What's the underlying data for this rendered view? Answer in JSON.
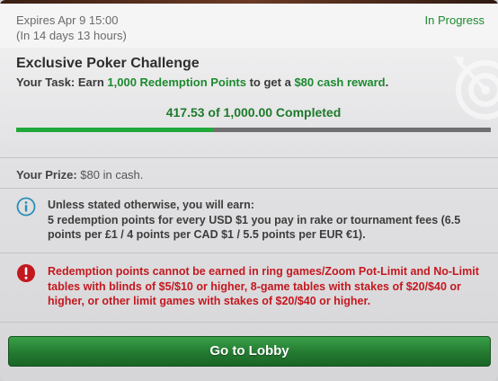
{
  "header": {
    "expires": "Expires Apr 9 15:00",
    "duration": "(In 14 days 13 hours)",
    "status": "In Progress"
  },
  "challenge": {
    "title": "Exclusive Poker Challenge",
    "task_prefix": "Your Task: Earn ",
    "task_points": "1,000 Redemption Points",
    "task_middle": " to get a ",
    "task_reward": "$80 cash reward",
    "task_suffix": ".",
    "progress_text": "417.53 of 1,000.00 Completed",
    "progress_fraction": 0.41753
  },
  "prize": {
    "label": "Your Prize:",
    "value": " $80 in cash."
  },
  "info": {
    "line1": "Unless stated otherwise, you will earn:",
    "line2": "5 redemption points for every USD $1 you pay in rake or tournament fees (6.5 points per £1 / 4 points per CAD $1 / 5.5 points per EUR €1)."
  },
  "warning": {
    "text": "Redemption points cannot be earned in ring games/Zoom Pot-Limit and No-Limit tables with blinds of $5/$10 or higher, 8-game tables with stakes of $20/$40 or higher, or other limit games with stakes of $20/$40 or higher."
  },
  "button": {
    "label": "Go to Lobby"
  },
  "icons": {
    "info": "info-icon",
    "warning": "warning-icon",
    "target": "target-icon"
  },
  "colors": {
    "accent_green": "#1c8a2e",
    "progress_fill": "#20a83b",
    "warning_red": "#c4181f",
    "button_green": "#237a30"
  }
}
